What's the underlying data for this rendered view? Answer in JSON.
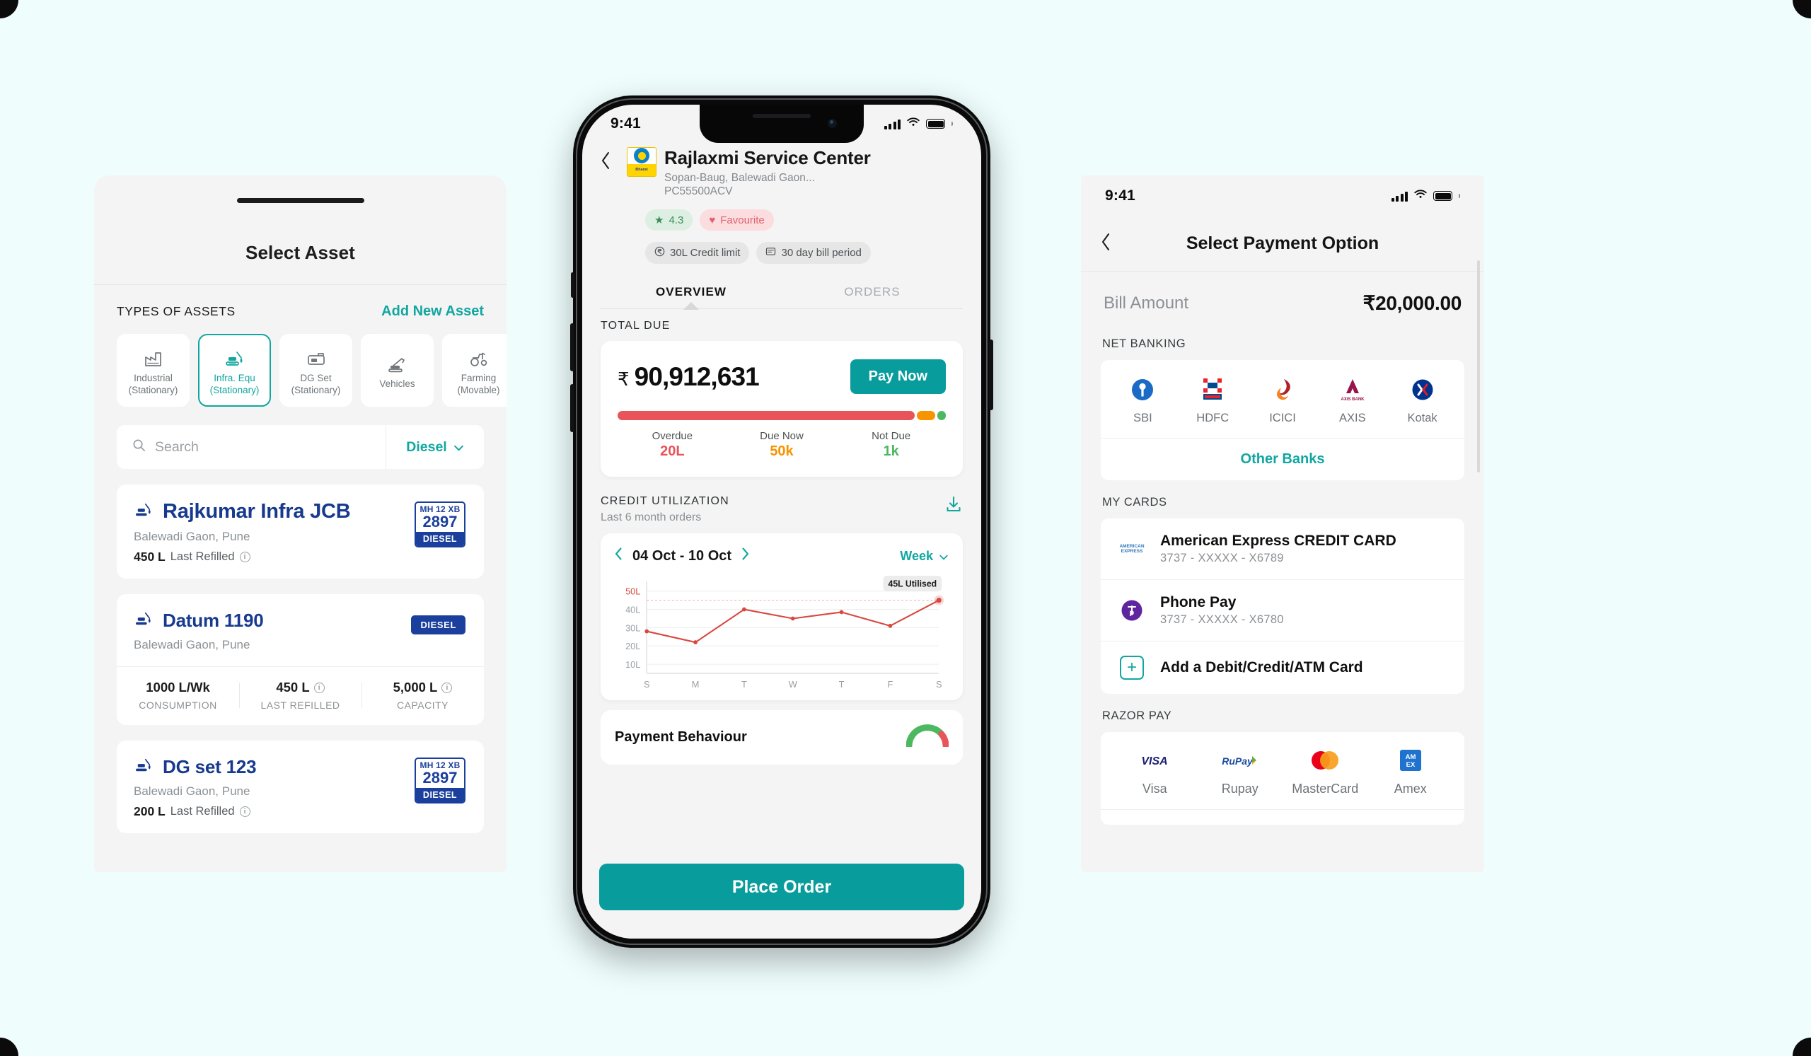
{
  "theme": {
    "background": "#effdfd",
    "teal": "#12a6a0",
    "teal_cta": "#099c9c",
    "navy": "#173a8f",
    "red": "#e8545a",
    "amber": "#f79400",
    "green": "#4cb860"
  },
  "select_asset": {
    "title": "Select Asset",
    "types_label": "TYPES OF ASSETS",
    "add_new_label": "Add New Asset",
    "asset_types": [
      {
        "line1": "Industrial",
        "line2": "(Stationary)",
        "icon": "factory-icon",
        "active": false
      },
      {
        "line1": "Infra. Equ",
        "line2": "(Stationary)",
        "icon": "excavator-icon",
        "active": true
      },
      {
        "line1": "DG Set",
        "line2": "(Stationary)",
        "icon": "generator-icon",
        "active": false
      },
      {
        "line1": "Vehicles",
        "line2": "",
        "icon": "crane-truck-icon",
        "active": false
      },
      {
        "line1": "Farming",
        "line2": "(Movable)",
        "icon": "tractor-icon",
        "active": false
      }
    ],
    "search_placeholder": "Search",
    "fuel_filter": "Diesel",
    "assets": [
      {
        "name": "Rajkumar Infra JCB",
        "location": "Balewadi Gaon, Pune",
        "refill_value": "450 L",
        "refill_label": "Last Refilled",
        "plate": {
          "state": "MH 12 XB",
          "number": "2897",
          "fuel": "DIESEL"
        },
        "badge": null,
        "stats": []
      },
      {
        "name": "Datum 1190",
        "location": "Balewadi Gaon, Pune",
        "refill_value": "",
        "refill_label": "",
        "plate": null,
        "badge": "DIESEL",
        "stats": [
          {
            "value": "1000 L/Wk",
            "label": "CONSUMPTION",
            "info": false
          },
          {
            "value": "450 L",
            "label": "LAST REFILLED",
            "info": true
          },
          {
            "value": "5,000 L",
            "label": "CAPACITY",
            "info": true
          }
        ]
      },
      {
        "name": "DG set 123",
        "location": "Balewadi Gaon, Pune",
        "refill_value": "200 L",
        "refill_label": "Last Refilled",
        "plate": {
          "state": "MH 12 XB",
          "number": "2897",
          "fuel": "DIESEL"
        },
        "badge": null,
        "stats": []
      }
    ]
  },
  "merchant": {
    "status_time": "9:41",
    "name": "Rajlaxmi Service Center",
    "address": "Sopan-Baug, Balewadi Gaon...",
    "code": "PC55500ACV",
    "logo_top": "Bharat",
    "logo_bottom": "Petroleum",
    "rating": "4.3",
    "favourite": "Favourite",
    "credit_limit": "30L Credit limit",
    "bill_period": "30 day bill period",
    "tabs": [
      {
        "label": "OVERVIEW",
        "active": true
      },
      {
        "label": "ORDERS",
        "active": false
      }
    ],
    "total_due_label": "TOTAL DUE",
    "currency": "₹",
    "total_due_amount": "90,912,631",
    "pay_now_label": "Pay Now",
    "breakdown": [
      {
        "label": "Overdue",
        "value": "20L",
        "color": "red"
      },
      {
        "label": "Due Now",
        "value": "50k",
        "color": "amb"
      },
      {
        "label": "Not Due",
        "value": "1k",
        "color": "grn"
      }
    ],
    "credit_util_title": "CREDIT UTILIZATION",
    "credit_util_sub": "Last 6 month orders",
    "download_icon": "download-icon",
    "date_range": "04 Oct - 10 Oct",
    "period": "Week",
    "payment_behaviour_title": "Payment Behaviour",
    "place_order_label": "Place Order"
  },
  "chart_data": {
    "type": "line",
    "title": "Credit Utilization",
    "subtitle": "Last 6 month orders",
    "categories": [
      "S",
      "M",
      "T",
      "W",
      "T",
      "F",
      "S"
    ],
    "values": [
      28,
      22,
      40,
      35,
      38.5,
      31,
      45
    ],
    "series": [
      {
        "name": "Utilised",
        "values": [
          28,
          22,
          40,
          35,
          38.5,
          31,
          45
        ]
      }
    ],
    "ytick_labels": [
      "50L",
      "40L",
      "30L",
      "20L",
      "10L"
    ],
    "ytick_values": [
      50,
      40,
      30,
      20,
      10
    ],
    "ylim": [
      5,
      53
    ],
    "xlabel": "",
    "ylabel": "",
    "grid": true,
    "legend": "none",
    "line_color": "#d8483f",
    "highlight_tick": "50L",
    "annotation": {
      "label": "45L Utilised",
      "x": "S",
      "y": 45
    }
  },
  "payment": {
    "status_time": "9:41",
    "title": "Select Payment Option",
    "bill_amount_label": "Bill Amount",
    "bill_amount_value": "₹20,000.00",
    "net_banking_label": "NET BANKING",
    "banks": [
      {
        "name": "SBI",
        "icon": "sbi-logo-icon"
      },
      {
        "name": "HDFC",
        "icon": "hdfc-logo-icon"
      },
      {
        "name": "ICICI",
        "icon": "icici-logo-icon"
      },
      {
        "name": "AXIS",
        "icon": "axis-logo-icon"
      },
      {
        "name": "Kotak",
        "icon": "kotak-logo-icon"
      }
    ],
    "other_banks_label": "Other Banks",
    "my_cards_label": "MY CARDS",
    "cards": [
      {
        "title": "American Express CREDIT CARD",
        "number": "3737 - XXXXX - X6789",
        "icon": "amex-logo-icon"
      },
      {
        "title": "Phone Pay",
        "number": "3737 - XXXXX - X6780",
        "icon": "phonepe-logo-icon"
      }
    ],
    "add_card_label": "Add a Debit/Credit/ATM Card",
    "razor_pay_label": "RAZOR PAY",
    "networks": [
      {
        "name": "Visa",
        "icon": "visa-logo-icon"
      },
      {
        "name": "Rupay",
        "icon": "rupay-logo-icon"
      },
      {
        "name": "MasterCard",
        "icon": "mastercard-logo-icon"
      },
      {
        "name": "Amex",
        "icon": "amex-logo-icon"
      }
    ]
  }
}
